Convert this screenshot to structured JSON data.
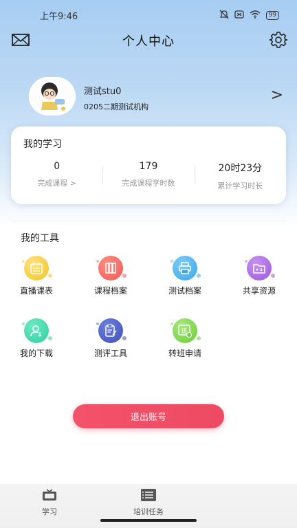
{
  "status_bar": {
    "time": "上午9:46",
    "battery": "99"
  },
  "header": {
    "title": "个人中心"
  },
  "profile": {
    "username": "测试stu0",
    "org": "0205二期测试机构",
    "arrow": ">"
  },
  "study": {
    "title": "我的学习",
    "stats": [
      {
        "value": "0",
        "label": "完成课程 >"
      },
      {
        "value": "179",
        "label": "完成课程学时数"
      },
      {
        "value": "20时23分",
        "label": "累计学习时长"
      }
    ]
  },
  "tools": {
    "title": "我的工具",
    "items": [
      {
        "label": "直播课表",
        "icon": "calendar-icon",
        "color": "#f4c324"
      },
      {
        "label": "课程档案",
        "icon": "books-icon",
        "color": "#ef5a5a"
      },
      {
        "label": "测试档案",
        "icon": "printer-icon",
        "color": "#3aa6ea"
      },
      {
        "label": "共享资源",
        "icon": "shared-folder-icon",
        "color": "#9b59d8"
      },
      {
        "label": "我的下载",
        "icon": "download-user-icon",
        "color": "#2fcfa0"
      },
      {
        "label": "测评工具",
        "icon": "clipboard-icon",
        "color": "#3e4fb8"
      },
      {
        "label": "转班申请",
        "icon": "class-transfer-icon",
        "color": "#6dcc3a"
      }
    ]
  },
  "logout": {
    "label": "退出账号"
  },
  "tabbar": {
    "items": [
      {
        "label": "学习",
        "icon": "tv-icon"
      },
      {
        "label": "培训任务",
        "icon": "list-icon"
      }
    ]
  }
}
